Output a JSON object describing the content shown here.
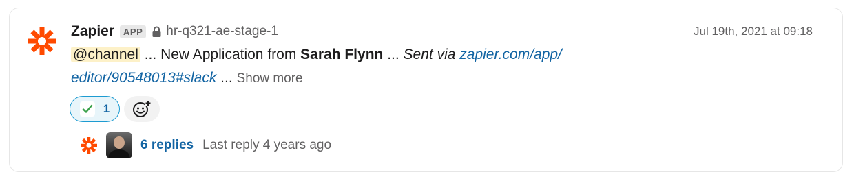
{
  "message": {
    "sender": "Zapier",
    "badge": "APP",
    "channel": "hr-q321-ae-stage-1",
    "timestamp": "Jul 19th, 2021 at 09:18",
    "mention": "@channel",
    "ellipsis1": " ... New Application from ",
    "applicant": "Sarah Flynn",
    "ellipsis2": " ... ",
    "sent_via": "Sent via ",
    "link_line1": "zapier.com/app/",
    "link_line2": "editor/90548013#slack",
    "ellipsis3": " ... ",
    "show_more": "Show more"
  },
  "reactions": [
    {
      "emoji": "white-check-mark",
      "count": "1"
    }
  ],
  "thread": {
    "replies": "6 replies",
    "last_reply": "Last reply 4 years ago"
  },
  "colors": {
    "zapier_orange": "#ff4a00",
    "link_blue": "#1264a3",
    "mention_bg": "#fdf1c8",
    "check_green": "#3aa14a"
  }
}
